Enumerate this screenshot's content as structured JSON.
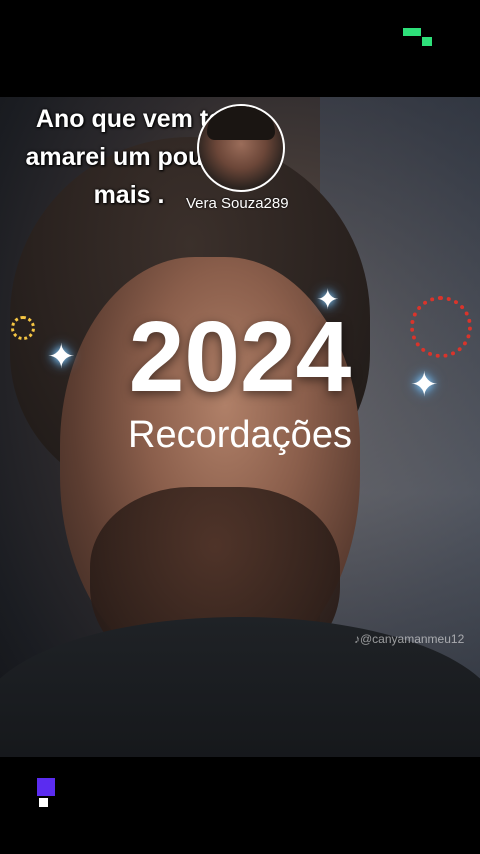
{
  "caption": {
    "line1": "Ano que vem te",
    "line2": "amarei um pouco",
    "line3": "mais ."
  },
  "creator": {
    "username": "Vera Souza289"
  },
  "overlay": {
    "year": "2024",
    "subtitle": "Recordações"
  },
  "watermark": {
    "text": "@canyamanmeu12"
  },
  "colors": {
    "logo_green": "#2ee07a",
    "logo_purple": "#5b2cf0",
    "sparkle": "#ffffff",
    "firework_yellow": "#f5c542",
    "firework_red": "#d9342b"
  },
  "icons": {
    "top_logo": "app-logo-icon",
    "bottom_logo": "brand-logo-icon",
    "sparkle": "sparkle-icon",
    "tiktok": "tiktok-icon"
  }
}
